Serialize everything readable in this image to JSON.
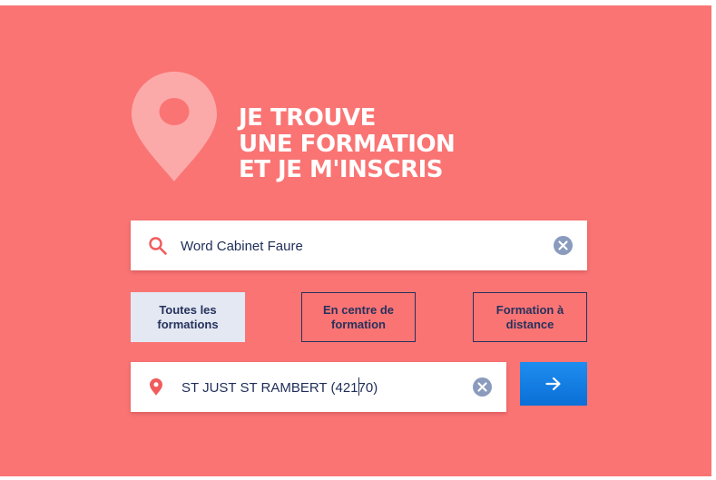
{
  "hero": {
    "headline_lines": [
      "JE TROUVE",
      "UNE FORMATION",
      "ET JE M'INSCRIS"
    ]
  },
  "search": {
    "value": "Word Cabinet Faure",
    "icon": "search-icon",
    "clear_icon": "clear-icon"
  },
  "tabs": [
    {
      "label_lines": [
        "Toutes les",
        "formations"
      ],
      "active": true
    },
    {
      "label_lines": [
        "En centre de",
        "formation"
      ],
      "active": false
    },
    {
      "label_lines": [
        "Formation à",
        "distance"
      ],
      "active": false
    }
  ],
  "location": {
    "value": "ST JUST ST RAMBERT (42170)",
    "icon": "map-pin-icon",
    "clear_icon": "clear-icon"
  },
  "submit": {
    "icon": "arrow-right-icon"
  },
  "colors": {
    "background": "#fa7474",
    "pin": "#fcaaa9",
    "text_dark": "#26325c",
    "accent": "#f05c5c",
    "button": "#1580e6",
    "tab_active_bg": "#e3e8f3",
    "clear_icon": "#8a9bbd"
  }
}
